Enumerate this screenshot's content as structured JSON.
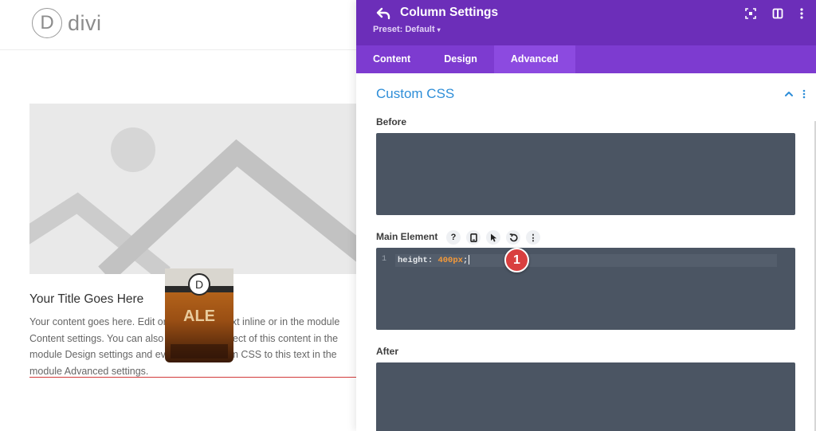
{
  "canvas": {
    "logo": {
      "mark": "D",
      "text": "divi"
    },
    "module": {
      "title": "Your Title Goes Here",
      "body_lines": [
        "Your content goes here. Edit or remove this text inline or in the module",
        "Content settings. You can also style every aspect of this content in the",
        "module Design settings and even apply custom CSS to this text in the",
        "module Advanced settings."
      ]
    },
    "product": {
      "label": "ALE",
      "mark": "D"
    }
  },
  "panel": {
    "title": "Column Settings",
    "preset": "Preset: Default",
    "header_icons": [
      "back-icon",
      "expand-icon",
      "sidebar-layout-icon",
      "more-vertical-icon"
    ],
    "tabs": [
      {
        "label": "Content",
        "active": false
      },
      {
        "label": "Design",
        "active": false
      },
      {
        "label": "Advanced",
        "active": true
      }
    ],
    "section": {
      "title": "Custom CSS",
      "state": "expanded"
    },
    "fields": {
      "before": {
        "label": "Before",
        "value": ""
      },
      "main_element": {
        "label": "Main Element",
        "tools": [
          "help-icon",
          "mobile-icon",
          "hover-cursor-icon",
          "reset-icon",
          "more-vertical-icon"
        ],
        "help_glyph": "?",
        "more_glyph": "⋮",
        "code": {
          "line_number": "1",
          "property": "height",
          "colon": ":",
          "value": "400px",
          "semicolon": ";"
        }
      },
      "after": {
        "label": "After",
        "value": ""
      }
    },
    "step_badge": "1"
  },
  "colors": {
    "header_purple": "#6c2eb9",
    "tabs_purple": "#7d3bd0",
    "active_tab": "#8c4ae0",
    "section_blue": "#2e8ed8",
    "code_bg": "#4b5563",
    "code_value": "#f59a39",
    "badge_red": "#d93f3f"
  }
}
